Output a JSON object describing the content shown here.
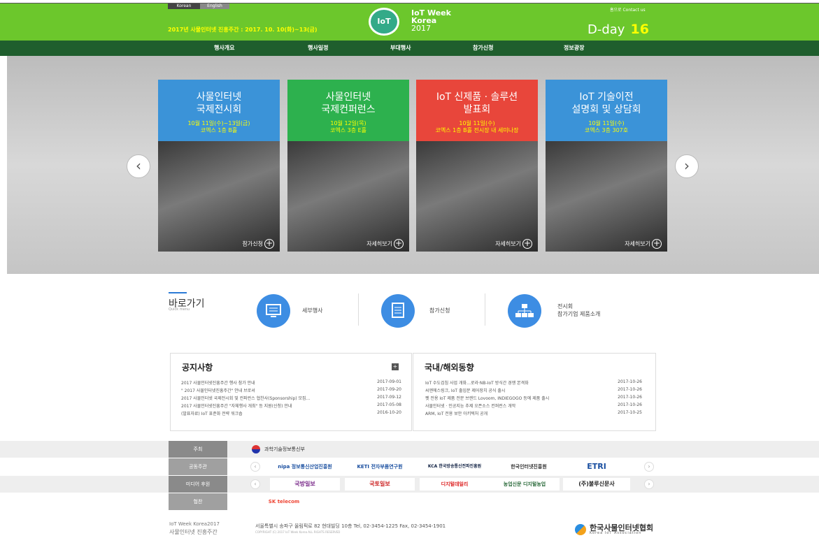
{
  "header": {
    "lang_korean": "Korean",
    "lang_english": "English",
    "event_dates": "2017년 사물인터넷 진흥주간 : 2017. 10. 10(화)~13(금)",
    "logo_mark": "IoT",
    "logo_line1": "IoT Week",
    "logo_line2": "Korea",
    "logo_line3": "2017",
    "top_links": "홈으로   Contact us",
    "dday_label": "D-day",
    "dday_value": "16"
  },
  "nav": [
    "행사개요",
    "행사일정",
    "부대행사",
    "참가신청",
    "정보광장"
  ],
  "cards": [
    {
      "title1": "사물인터넷",
      "title2": "국제전시회",
      "date": "10월 11일(수)~13일(금)",
      "venue": "코엑스 1층 B홀",
      "more": "참가신청",
      "color": "#3b93d8"
    },
    {
      "title1": "사물인터넷",
      "title2": "국제컨퍼런스",
      "date": "10월 12일(목)",
      "venue": "코엑스 3층 E홀",
      "more": "자세히보기",
      "color": "#2db14e"
    },
    {
      "title1": "IoT 신제품 · 솔루션",
      "title2": "발표회",
      "date": "10월 11일(수)",
      "venue": "코엑스 1층 B홀 전시장 내 세미나장",
      "more": "자세히보기",
      "color": "#e8463b"
    },
    {
      "title1": "IoT 기술이전",
      "title2": "설명회 및 상담회",
      "date": "10월 11일(수)",
      "venue": "코엑스 3층 307호",
      "more": "자세히보기",
      "color": "#3b93d8"
    }
  ],
  "quick": {
    "title": "바로가기",
    "subtitle": "Quick menu",
    "items": [
      {
        "label": "세부행사",
        "icon": "monitor-icon"
      },
      {
        "label": "참가신청",
        "icon": "form-icon"
      },
      {
        "label1": "전시회",
        "label2": "참가기업 제품소개",
        "icon": "network-icon"
      }
    ]
  },
  "notice": {
    "title": "공지사항",
    "more": "+",
    "rows": [
      {
        "text": "2017 사물인터넷진흥주간 행사 참가 안내",
        "date": "2017-09-01"
      },
      {
        "text": "\" 2017 사물인터넷진흥주간\" 안내 브로셔",
        "date": "2017-09-20"
      },
      {
        "text": "2017 사물인터넷 국제전시회 및 컨퍼런스 협찬사(Sponsorship) 모집...",
        "date": "2017-09-12"
      },
      {
        "text": "2017 사물인터넷진흥주간 \"자체행사 개최\" 등 지원(신청) 안내",
        "date": "2017-05-08"
      },
      {
        "text": "(발표자료) IoT 표준화 전략 워크숍",
        "date": "2016-10-20"
      }
    ]
  },
  "news": {
    "title": "국내/해외동향",
    "rows": [
      {
        "text": "IoT 수도검침 사업 개화…로라·NB-IoT 방식간 경쟁 본격화",
        "date": "2017-10-26"
      },
      {
        "text": "씨엔에스링크, IoT 출입문 제어장치 공식 출시",
        "date": "2017-10-26"
      },
      {
        "text": "펫 전용 IoT 제품 전문 브랜드 Lovoom, INDIEGOGO 등에 제품 출시",
        "date": "2017-10-26"
      },
      {
        "text": "사물인터넷 · 인공지능 추제 오픈소스 컨퍼런스 개막",
        "date": "2017-10-26"
      },
      {
        "text": "ARM, IoT 전용 보안 아키텍처 공개",
        "date": "2017-10-25"
      }
    ]
  },
  "sponsors": {
    "host_label": "주최",
    "host": "과학기술정보통신부",
    "organizer_label": "공동주관",
    "organizers": [
      "nipa 정보통신산업진흥원",
      "KETI 전자부품연구원",
      "KCA 한국방송통신전파진흥원",
      "한국인터넷진흥원",
      "ETRI"
    ],
    "media_label": "미디어 후원",
    "media": [
      "국방일보",
      "국토일보",
      "디지털데일리",
      "농업신문 디지털농업",
      "(주)불루신문사"
    ],
    "sponsor_label": "협찬",
    "sponsor": "SK telecom"
  },
  "footer": {
    "brand1": "IoT Week Korea2017",
    "brand2": "사물인터넷 진흥주간",
    "address": "서울특별시 송파구 올림픽로 82 현대빌딩 10층 Tel, 02-3454-1225 Fax, 02-3454-1901",
    "copyright": "COPYRIGHT (C) 2017 IoT Week Korea ALL RIGHTS RESERVED",
    "assoc_ko": "한국사물인터넷협회",
    "assoc_en": "Korea IoT Association"
  }
}
